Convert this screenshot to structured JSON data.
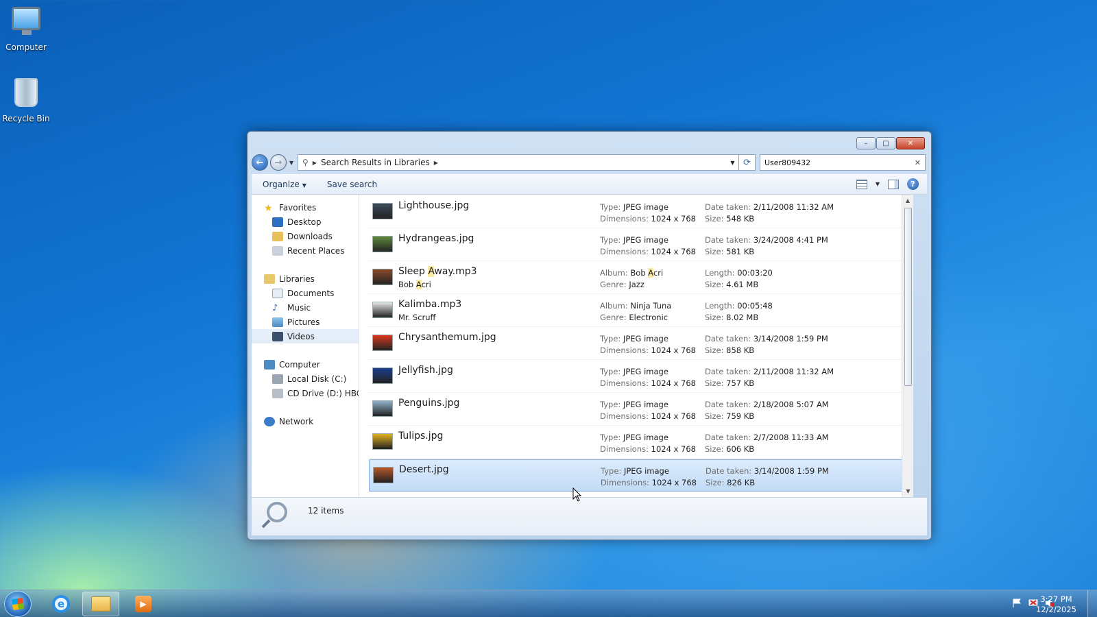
{
  "desktop": {
    "icons": [
      {
        "label": "Computer"
      },
      {
        "label": "Recycle Bin"
      }
    ]
  },
  "window": {
    "controls": {
      "minimize": "–",
      "maximize": "□",
      "close": "✕"
    },
    "address": {
      "segments": [
        "Search Results in Libraries"
      ]
    },
    "search": {
      "value": "User809432"
    },
    "toolbar": {
      "organize_label": "Organize",
      "save_search_label": "Save search"
    },
    "nav_pane": {
      "favorites": {
        "label": "Favorites",
        "items": [
          "Desktop",
          "Downloads",
          "Recent Places"
        ]
      },
      "libraries": {
        "label": "Libraries",
        "items": [
          "Documents",
          "Music",
          "Pictures",
          "Videos"
        ]
      },
      "computer": {
        "label": "Computer",
        "items": [
          "Local Disk (C:)",
          "CD Drive (D:) HBCD_"
        ]
      },
      "network": {
        "label": "Network"
      }
    },
    "files": [
      {
        "name": "Lighthouse.jpg",
        "sub": "",
        "k1": "Type:",
        "v1": "JPEG image",
        "k2": "Dimensions:",
        "v2": "1024 x 768",
        "k3": "Date taken:",
        "v3": "2/11/2008 11:32 AM",
        "k4": "Size:",
        "v4": "548 KB",
        "thumb_color": "#3c4b5a"
      },
      {
        "name": "Hydrangeas.jpg",
        "sub": "",
        "k1": "Type:",
        "v1": "JPEG image",
        "k2": "Dimensions:",
        "v2": "1024 x 768",
        "k3": "Date taken:",
        "v3": "3/24/2008 4:41 PM",
        "k4": "Size:",
        "v4": "581 KB",
        "thumb_color": "#5d8a3c"
      },
      {
        "name_pre": "Sleep ",
        "name_hl": "A",
        "name_post": "way.mp3",
        "sub_pre": "Bob ",
        "sub_hl": "A",
        "sub_post": "cri",
        "k1": "Album:",
        "v1_pre": "Bob ",
        "v1_hl": "A",
        "v1_post": "cri",
        "k2": "Genre:",
        "v2": "Jazz",
        "k3": "Length:",
        "v3": "00:03:20",
        "k4": "Size:",
        "v4": "4.61 MB",
        "thumb_color": "#8a4a2a"
      },
      {
        "name": "Kalimba.mp3",
        "sub": "Mr. Scruff",
        "k1": "Album:",
        "v1": "Ninja Tuna",
        "k2": "Genre:",
        "v2": "Electronic",
        "k3": "Length:",
        "v3": "00:05:48",
        "k4": "Size:",
        "v4": "8.02 MB",
        "thumb_color": "#e6e6e6"
      },
      {
        "name": "Chrysanthemum.jpg",
        "sub": "",
        "k1": "Type:",
        "v1": "JPEG image",
        "k2": "Dimensions:",
        "v2": "1024 x 768",
        "k3": "Date taken:",
        "v3": "3/14/2008 1:59 PM",
        "k4": "Size:",
        "v4": "858 KB",
        "thumb_color": "#d8391e"
      },
      {
        "name": "Jellyfish.jpg",
        "sub": "",
        "k1": "Type:",
        "v1": "JPEG image",
        "k2": "Dimensions:",
        "v2": "1024 x 768",
        "k3": "Date taken:",
        "v3": "2/11/2008 11:32 AM",
        "k4": "Size:",
        "v4": "757 KB",
        "thumb_color": "#1b3f8c"
      },
      {
        "name": "Penguins.jpg",
        "sub": "",
        "k1": "Type:",
        "v1": "JPEG image",
        "k2": "Dimensions:",
        "v2": "1024 x 768",
        "k3": "Date taken:",
        "v3": "2/18/2008 5:07 AM",
        "k4": "Size:",
        "v4": "759 KB",
        "thumb_color": "#8fb0c8"
      },
      {
        "name": "Tulips.jpg",
        "sub": "",
        "k1": "Type:",
        "v1": "JPEG image",
        "k2": "Dimensions:",
        "v2": "1024 x 768",
        "k3": "Date taken:",
        "v3": "2/7/2008 11:33 AM",
        "k4": "Size:",
        "v4": "606 KB",
        "thumb_color": "#e3b21c"
      },
      {
        "name": "Desert.jpg",
        "sub": "",
        "k1": "Type:",
        "v1": "JPEG image",
        "k2": "Dimensions:",
        "v2": "1024 x 768",
        "k3": "Date taken:",
        "v3": "3/14/2008 1:59 PM",
        "k4": "Size:",
        "v4": "826 KB",
        "thumb_color": "#b8582a"
      }
    ],
    "status": {
      "items_count": "12 items"
    }
  },
  "taskbar": {
    "clock": {
      "time": "3:27 PM",
      "date": "12/2/2025"
    },
    "ie_glyph": "e",
    "media_glyph": "▶"
  },
  "colors": {
    "accent": "#1e5fb4",
    "selection": "#c2dcf7",
    "highlight": "#fbe9a6"
  }
}
